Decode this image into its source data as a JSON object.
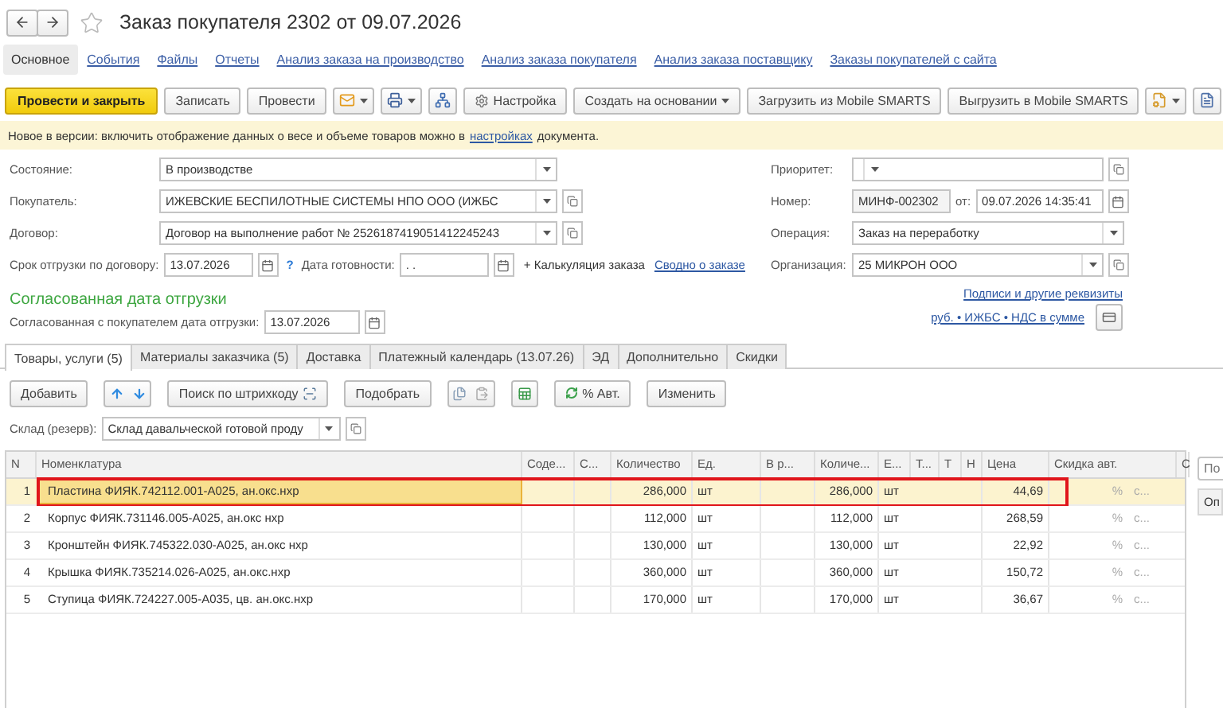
{
  "window": {
    "title": "Заказ покупателя 2302 от 09.07.2026",
    "favorite": false
  },
  "sections": [
    {
      "label": "Основное",
      "selected": true
    },
    {
      "label": "События",
      "selected": false
    },
    {
      "label": "Файлы",
      "selected": false
    },
    {
      "label": "Отчеты",
      "selected": false
    },
    {
      "label": "Анализ заказа на производство",
      "selected": false
    },
    {
      "label": "Анализ заказа покупателя",
      "selected": false
    },
    {
      "label": "Анализ заказа поставщику",
      "selected": false
    },
    {
      "label": "Заказы покупателей с сайта",
      "selected": false
    }
  ],
  "toolbar": [
    {
      "kind": "primary",
      "label": "Провести и закрыть"
    },
    {
      "kind": "button",
      "label": "Записать"
    },
    {
      "kind": "button",
      "label": "Провести"
    },
    {
      "kind": "icon-menu"
    },
    {
      "kind": "icon-menu"
    },
    {
      "kind": "icon"
    },
    {
      "kind": "icon-button",
      "label": "Настройка"
    },
    {
      "kind": "menu",
      "label": "Создать на основании"
    },
    {
      "kind": "button",
      "label": "Загрузить из Mobile SMARTS"
    },
    {
      "kind": "button",
      "label": "Выгрузить в Mobile SMARTS"
    },
    {
      "kind": "icon-menu"
    },
    {
      "kind": "icon"
    }
  ],
  "notice": {
    "text": "Новое в версии: включить отображение данных о весе и объеме товаров можно в",
    "link": "настройках",
    "after": "документа."
  },
  "left_fields": [
    {
      "label": "Состояние:",
      "value": "В производстве",
      "openable": false
    },
    {
      "label": "Покупатель:",
      "value": "ИЖЕВСКИЕ БЕСПИЛОТНЫЕ СИСТЕМЫ НПО ООО (ИЖБС",
      "openable": true
    },
    {
      "label": "Договор:",
      "value": "Договор на выполнение работ № 2526187419051412245243",
      "openable": true
    }
  ],
  "deadline": {
    "label": "Срок отгрузки по договору:",
    "value": "13.07.2026",
    "help": "?",
    "ready_label": "Дата готовности:",
    "ready_value": ". .",
    "calc_link": "+ Калькуляция заказа",
    "summary_link": "Сводно о заказе"
  },
  "right_fields": {
    "priority": {
      "label": "Приоритет:"
    },
    "number": {
      "label": "Номер:",
      "value": "МИНФ-002302",
      "date_label": "от:",
      "date": "09.07.2026 14:35:41"
    },
    "operation": {
      "label": "Операция:",
      "value": "Заказ на переработку"
    },
    "organization": {
      "label": "Организация:",
      "value": "25 МИКРОН ООО"
    }
  },
  "signatures_link": "Подписи и другие реквизиты",
  "agreed": {
    "title": "Согласованная дата отгрузки",
    "label": "Согласованная с покупателем дата отгрузки:",
    "value": "13.07.2026"
  },
  "currency_link": "руб. • ИЖБС • НДС в сумме",
  "tabs": [
    {
      "label": "Товары, услуги (5)",
      "selected": true
    },
    {
      "label": "Материалы заказчика (5)",
      "selected": false
    },
    {
      "label": "Доставка",
      "selected": false
    },
    {
      "label": "Платежный календарь (13.07.26)",
      "selected": false
    },
    {
      "label": "ЭД",
      "selected": false
    },
    {
      "label": "Дополнительно",
      "selected": false
    },
    {
      "label": "Скидки",
      "selected": false
    }
  ],
  "table_toolbar": [
    {
      "kind": "button",
      "label": "Добавить"
    },
    {
      "kind": "arrows"
    },
    {
      "kind": "search",
      "label": "Поиск по штрихкоду"
    },
    {
      "kind": "button",
      "label": "Подобрать"
    },
    {
      "kind": "icon-pair"
    },
    {
      "kind": "icon"
    },
    {
      "kind": "refresh",
      "label": "% Авт."
    },
    {
      "kind": "button",
      "label": "Изменить"
    }
  ],
  "warehouse": {
    "label": "Склад (резерв):",
    "value": "Склад давальческой готовой проду"
  },
  "table": {
    "columns": [
      "N",
      "Номенклатура",
      "Соде...",
      "С...",
      "Количество",
      "Ед.",
      "В р...",
      "Количе...",
      "Е...",
      "Т...",
      "Т",
      "Н",
      "Цена",
      "Скидка авт.",
      "С"
    ],
    "rows": [
      {
        "n": "1",
        "name": "Пластина ФИЯК.742112.001-А025, ан.окс.нхр",
        "qty": "286,000",
        "unit": "шт",
        "qty2": "286,000",
        "unit2": "шт",
        "price": "44,69",
        "discount": "%",
        "discount_2": "с...",
        "selected": true,
        "framed": true
      },
      {
        "n": "2",
        "name": "Корпус ФИЯК.731146.005-А025, ан.окс нхр",
        "qty": "112,000",
        "unit": "шт",
        "qty2": "112,000",
        "unit2": "шт",
        "price": "268,59",
        "discount": "%",
        "discount_2": "с...",
        "selected": false,
        "framed": false
      },
      {
        "n": "3",
        "name": "Кронштейн ФИЯК.745322.030-А025, ан.окс нхр",
        "qty": "130,000",
        "unit": "шт",
        "qty2": "130,000",
        "unit2": "шт",
        "price": "22,92",
        "discount": "%",
        "discount_2": "с...",
        "selected": false,
        "framed": false
      },
      {
        "n": "4",
        "name": "Крышка ФИЯК.735214.026-А025, ан.окс.нхр",
        "qty": "360,000",
        "unit": "шт",
        "qty2": "360,000",
        "unit2": "шт",
        "price": "150,72",
        "discount": "%",
        "discount_2": "с...",
        "selected": false,
        "framed": false
      },
      {
        "n": "5",
        "name": "Ступица ФИЯК.724227.005-А035, цв. ан.окс.нхр",
        "qty": "170,000",
        "unit": "шт",
        "qty2": "170,000",
        "unit2": "шт",
        "price": "36,67",
        "discount": "%",
        "discount_2": "с...",
        "selected": false,
        "framed": false
      }
    ]
  },
  "side_panel": {
    "search_placeholder": "По",
    "header": "Оп"
  }
}
